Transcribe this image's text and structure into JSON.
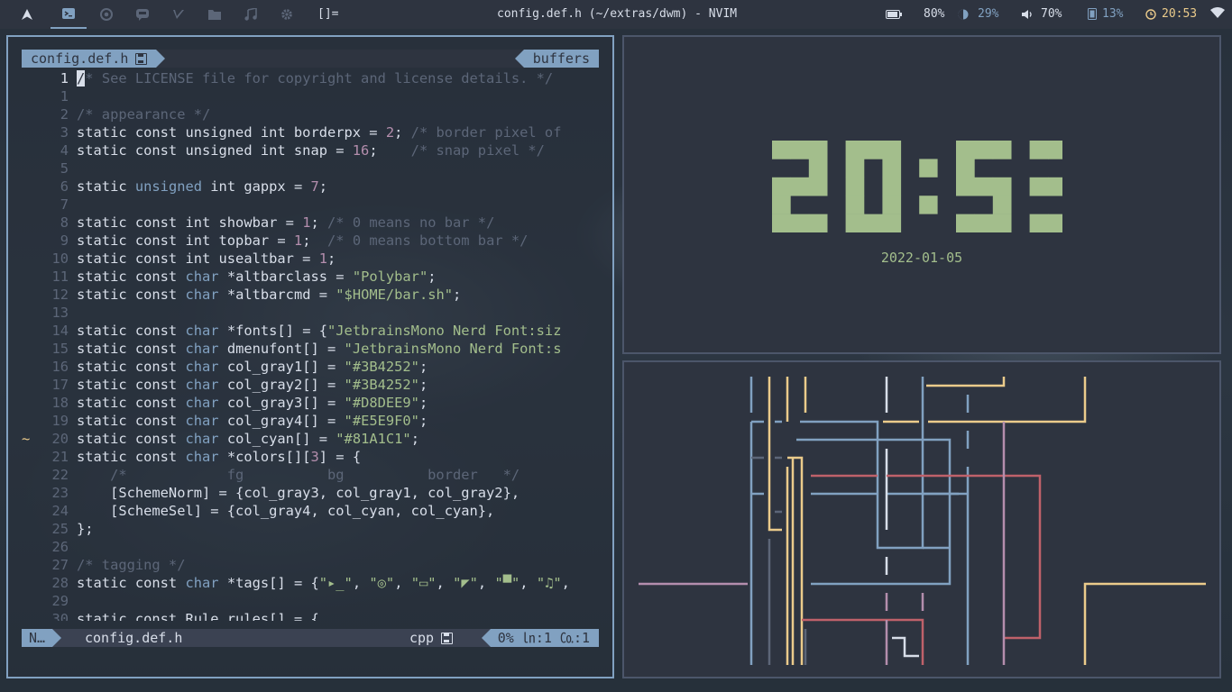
{
  "topbar": {
    "workspaces": [
      {
        "icon": "arch-logo-icon"
      },
      {
        "icon": "terminal-icon",
        "active": true
      },
      {
        "icon": "chrome-icon"
      },
      {
        "icon": "chat-icon"
      },
      {
        "icon": "code-editor-icon"
      },
      {
        "icon": "folder-icon"
      },
      {
        "icon": "music-note-icon"
      },
      {
        "icon": "gear-icon"
      }
    ],
    "layout_symbol": "[]=",
    "window_title": "config.def.h (~/extras/dwm) - NVIM",
    "battery": "80%",
    "brightness": "29%",
    "volume": "70%",
    "memory": "13%",
    "time": "20:53",
    "colors": {
      "accent": "#81a1c1",
      "bar_bg": "#2e3440"
    }
  },
  "nvim": {
    "tab_file": "config.def.h",
    "tab_buffers": "buffers",
    "lines": [
      {
        "n": "1",
        "segs": [
          {
            "c": "cursor",
            "t": "/"
          },
          {
            "c": "cm",
            "t": "* See LICENSE file for copyright and license details. */"
          }
        ],
        "cur": true
      },
      {
        "n": "1",
        "segs": []
      },
      {
        "n": "2",
        "segs": [
          {
            "c": "cm",
            "t": "/* appearance */"
          }
        ]
      },
      {
        "n": "3",
        "segs": [
          {
            "c": "kw",
            "t": "static const unsigned int borderpx = "
          },
          {
            "c": "num",
            "t": "2"
          },
          {
            "c": "kw",
            "t": "; "
          },
          {
            "c": "cm",
            "t": "/* border pixel of"
          }
        ]
      },
      {
        "n": "4",
        "segs": [
          {
            "c": "kw",
            "t": "static const unsigned int snap = "
          },
          {
            "c": "num",
            "t": "16"
          },
          {
            "c": "kw",
            "t": ";    "
          },
          {
            "c": "cm",
            "t": "/* snap pixel */"
          }
        ]
      },
      {
        "n": "5",
        "segs": []
      },
      {
        "n": "6",
        "segs": [
          {
            "c": "kw",
            "t": "static "
          },
          {
            "c": "ty",
            "t": "unsigned"
          },
          {
            "c": "kw",
            "t": " int gappx = "
          },
          {
            "c": "num",
            "t": "7"
          },
          {
            "c": "kw",
            "t": ";"
          }
        ]
      },
      {
        "n": "7",
        "segs": []
      },
      {
        "n": "8",
        "segs": [
          {
            "c": "kw",
            "t": "static const int showbar = "
          },
          {
            "c": "num",
            "t": "1"
          },
          {
            "c": "kw",
            "t": "; "
          },
          {
            "c": "cm",
            "t": "/* 0 means no bar */"
          }
        ]
      },
      {
        "n": "9",
        "segs": [
          {
            "c": "kw",
            "t": "static const int topbar = "
          },
          {
            "c": "num",
            "t": "1"
          },
          {
            "c": "kw",
            "t": ";  "
          },
          {
            "c": "cm",
            "t": "/* 0 means bottom bar */"
          }
        ]
      },
      {
        "n": "10",
        "segs": [
          {
            "c": "kw",
            "t": "static const int usealtbar = "
          },
          {
            "c": "num",
            "t": "1"
          },
          {
            "c": "kw",
            "t": ";"
          }
        ]
      },
      {
        "n": "11",
        "segs": [
          {
            "c": "kw",
            "t": "static const "
          },
          {
            "c": "ty",
            "t": "char"
          },
          {
            "c": "kw",
            "t": " *altbarclass = "
          },
          {
            "c": "str",
            "t": "\"Polybar\""
          },
          {
            "c": "kw",
            "t": ";"
          }
        ]
      },
      {
        "n": "12",
        "segs": [
          {
            "c": "kw",
            "t": "static const "
          },
          {
            "c": "ty",
            "t": "char"
          },
          {
            "c": "kw",
            "t": " *altbarcmd = "
          },
          {
            "c": "str",
            "t": "\"$HOME/bar.sh\""
          },
          {
            "c": "kw",
            "t": ";"
          }
        ]
      },
      {
        "n": "13",
        "segs": []
      },
      {
        "n": "14",
        "segs": [
          {
            "c": "kw",
            "t": "static const "
          },
          {
            "c": "ty",
            "t": "char"
          },
          {
            "c": "kw",
            "t": " *fonts[] = {"
          },
          {
            "c": "str",
            "t": "\"JetbrainsMono Nerd Font:siz"
          }
        ]
      },
      {
        "n": "15",
        "segs": [
          {
            "c": "kw",
            "t": "static const "
          },
          {
            "c": "ty",
            "t": "char"
          },
          {
            "c": "kw",
            "t": " dmenufont[] = "
          },
          {
            "c": "str",
            "t": "\"JetbrainsMono Nerd Font:s"
          }
        ]
      },
      {
        "n": "16",
        "segs": [
          {
            "c": "kw",
            "t": "static const "
          },
          {
            "c": "ty",
            "t": "char"
          },
          {
            "c": "kw",
            "t": " col_gray1[] = "
          },
          {
            "c": "str",
            "t": "\"#3B4252\""
          },
          {
            "c": "kw",
            "t": ";"
          }
        ]
      },
      {
        "n": "17",
        "segs": [
          {
            "c": "kw",
            "t": "static const "
          },
          {
            "c": "ty",
            "t": "char"
          },
          {
            "c": "kw",
            "t": " col_gray2[] = "
          },
          {
            "c": "str",
            "t": "\"#3B4252\""
          },
          {
            "c": "kw",
            "t": ";"
          }
        ]
      },
      {
        "n": "18",
        "segs": [
          {
            "c": "kw",
            "t": "static const "
          },
          {
            "c": "ty",
            "t": "char"
          },
          {
            "c": "kw",
            "t": " col_gray3[] = "
          },
          {
            "c": "str",
            "t": "\"#D8DEE9\""
          },
          {
            "c": "kw",
            "t": ";"
          }
        ]
      },
      {
        "n": "19",
        "segs": [
          {
            "c": "kw",
            "t": "static const "
          },
          {
            "c": "ty",
            "t": "char"
          },
          {
            "c": "kw",
            "t": " col_gray4[] = "
          },
          {
            "c": "str",
            "t": "\"#E5E9F0\""
          },
          {
            "c": "kw",
            "t": ";"
          }
        ]
      },
      {
        "n": "20",
        "sign": "~",
        "segs": [
          {
            "c": "kw",
            "t": "static const "
          },
          {
            "c": "ty",
            "t": "char"
          },
          {
            "c": "kw",
            "t": " col_cyan[] = "
          },
          {
            "c": "str",
            "t": "\"#81A1C1\""
          },
          {
            "c": "kw",
            "t": ";"
          }
        ]
      },
      {
        "n": "21",
        "segs": [
          {
            "c": "kw",
            "t": "static const "
          },
          {
            "c": "ty",
            "t": "char"
          },
          {
            "c": "kw",
            "t": " *colors[]["
          },
          {
            "c": "num",
            "t": "3"
          },
          {
            "c": "kw",
            "t": "] = {"
          }
        ]
      },
      {
        "n": "22",
        "segs": [
          {
            "c": "cm",
            "t": "    /*            fg          bg          border   */"
          }
        ]
      },
      {
        "n": "23",
        "segs": [
          {
            "c": "kw",
            "t": "    [SchemeNorm] = {col_gray3, col_gray1, col_gray2},"
          }
        ]
      },
      {
        "n": "24",
        "segs": [
          {
            "c": "kw",
            "t": "    [SchemeSel] = {col_gray4, col_cyan, col_cyan},"
          }
        ]
      },
      {
        "n": "25",
        "segs": [
          {
            "c": "kw",
            "t": "};"
          }
        ]
      },
      {
        "n": "26",
        "segs": []
      },
      {
        "n": "27",
        "segs": [
          {
            "c": "cm",
            "t": "/* tagging */"
          }
        ]
      },
      {
        "n": "28",
        "segs": [
          {
            "c": "kw",
            "t": "static const "
          },
          {
            "c": "ty",
            "t": "char"
          },
          {
            "c": "kw",
            "t": " *tags[] = {"
          },
          {
            "c": "str",
            "t": "\"▸_\""
          },
          {
            "c": "kw",
            "t": ", "
          },
          {
            "c": "str",
            "t": "\"◎\""
          },
          {
            "c": "kw",
            "t": ", "
          },
          {
            "c": "str",
            "t": "\"▭\""
          },
          {
            "c": "kw",
            "t": ", "
          },
          {
            "c": "str",
            "t": "\"◤\""
          },
          {
            "c": "kw",
            "t": ", "
          },
          {
            "c": "str",
            "t": "\"▀\""
          },
          {
            "c": "kw",
            "t": ", "
          },
          {
            "c": "str",
            "t": "\"♫\""
          },
          {
            "c": "kw",
            "t": ","
          }
        ]
      },
      {
        "n": "29",
        "segs": []
      },
      {
        "n": "30",
        "segs": [
          {
            "c": "kw",
            "t": "static const Rule rules[] = {"
          }
        ]
      }
    ],
    "statusline": {
      "mode": "N…",
      "file": "config.def.h",
      "filetype": "cpp",
      "percent": "0%",
      "line": "㏑:1",
      "col": "㏇:1"
    }
  },
  "clock": {
    "time": "20:53",
    "date": "2022-01-05",
    "color": "#a3be8c"
  }
}
